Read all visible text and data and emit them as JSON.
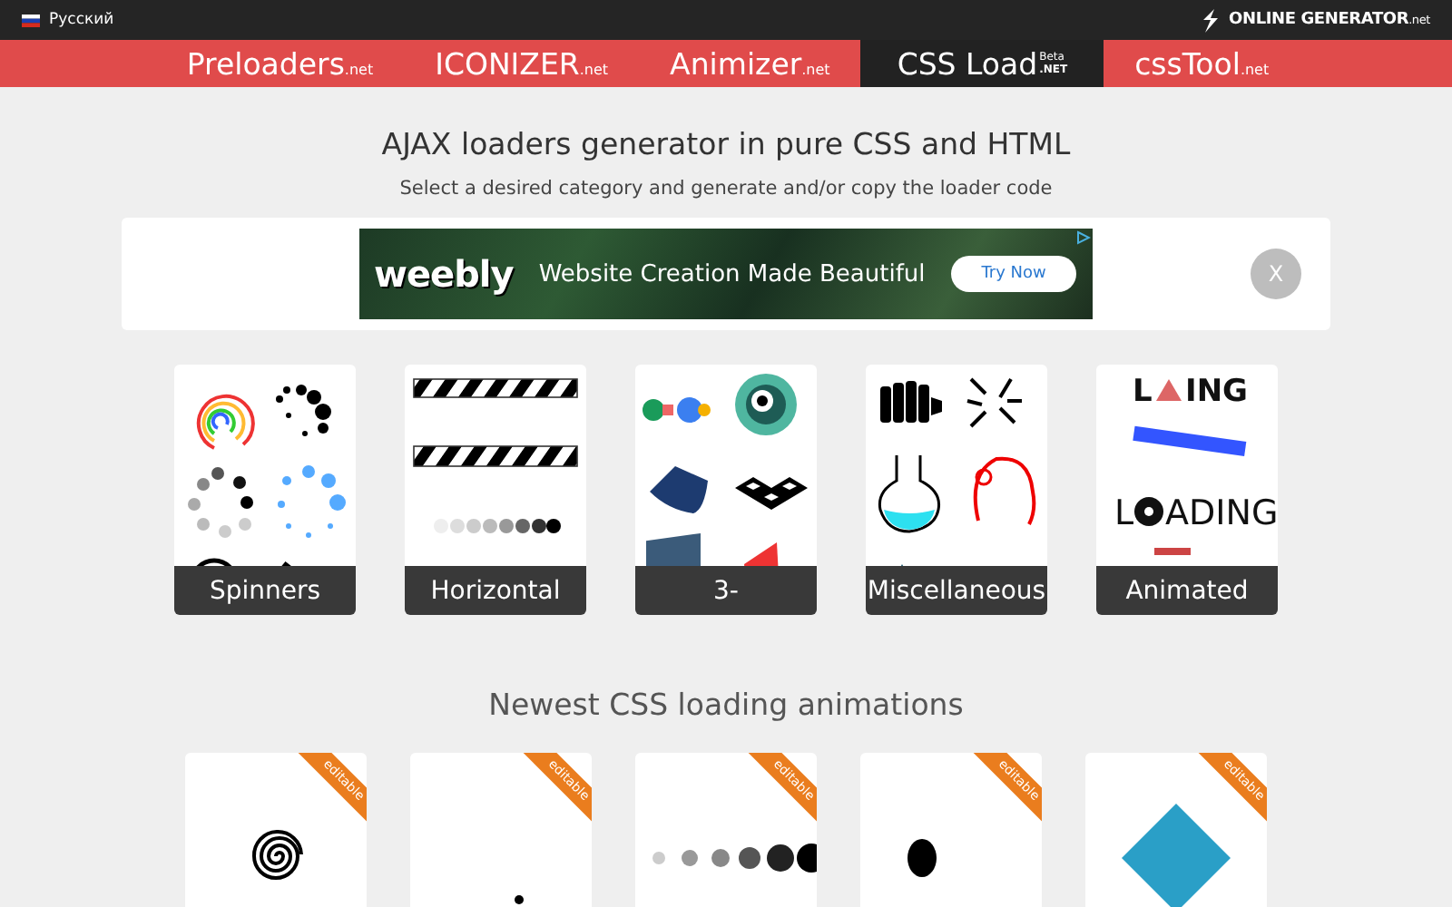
{
  "language": {
    "label": "Русский"
  },
  "brand": {
    "name": "ONLINE GENERATOR",
    "suffix": ".net"
  },
  "nav": [
    {
      "name": "Preloaders",
      "suffix": ".net",
      "selected": false
    },
    {
      "name": "ICONIZER",
      "suffix": ".net",
      "selected": false
    },
    {
      "name": "Animizer",
      "suffix": ".net",
      "selected": false
    },
    {
      "name": "CSS Load",
      "badge": "Beta",
      "suffix": ".NET",
      "selected": true
    },
    {
      "name": "cssTool",
      "suffix": ".net",
      "selected": false
    }
  ],
  "heading": "AJAX loaders generator in pure CSS and HTML",
  "subheading": "Select a desired category and generate and/or copy the loader code",
  "ad": {
    "logo": "weebly",
    "text": "Website Creation Made Beautiful",
    "button": "Try Now",
    "close": "X"
  },
  "categories": [
    {
      "label": "Spinners",
      "kind": "spinners"
    },
    {
      "label": "Horizontal",
      "kind": "bars"
    },
    {
      "label": "3-",
      "kind": "solids"
    },
    {
      "label": "Miscellaneous",
      "kind": "misc"
    },
    {
      "label": "Animated",
      "kind": "text",
      "preview_texts": [
        "L",
        "ING",
        "L",
        "ADING"
      ]
    }
  ],
  "newest": {
    "heading": "Newest CSS loading animations",
    "items": [
      {
        "ribbon": "editable",
        "kind": "spiral"
      },
      {
        "ribbon": "editable",
        "kind": "dot"
      },
      {
        "ribbon": "editable",
        "kind": "dots"
      },
      {
        "ribbon": "editable",
        "kind": "ellipse"
      },
      {
        "ribbon": "editable",
        "kind": "diamond"
      }
    ]
  }
}
